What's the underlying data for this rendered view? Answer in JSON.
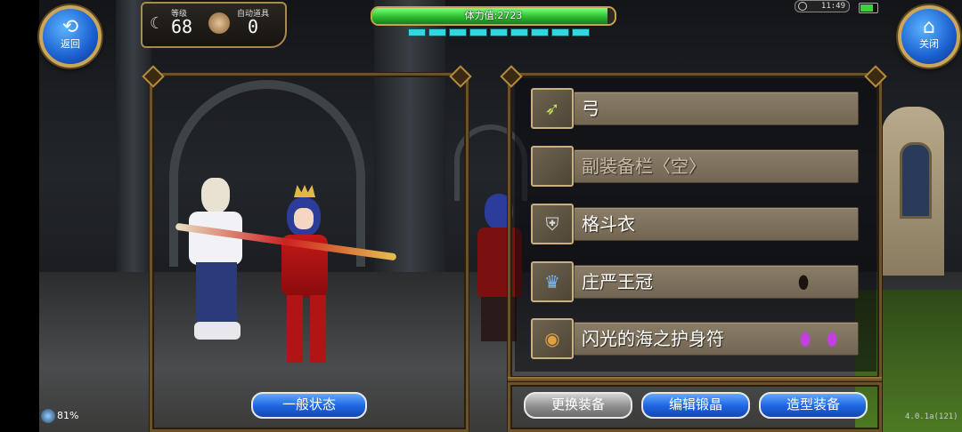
{
  "top_left": {
    "back_label": "返回",
    "back_glyph": "⟲",
    "level_label": "等级",
    "level_value": "68",
    "auto_item_label": "自动道具",
    "auto_item_value": "0"
  },
  "top_right": {
    "close_label": "关闭",
    "close_glyph": "⌂",
    "clock": "11:49"
  },
  "stamina": {
    "text": "体力值:2723",
    "fill_fraction": 0.97,
    "segments": 9
  },
  "equipment": [
    {
      "label": "弓",
      "icon": "bow-icon",
      "empty": false,
      "gems": 0
    },
    {
      "label": "副装备栏〈空〉",
      "icon": "empty-slot",
      "empty": true,
      "gems": 0
    },
    {
      "label": "格斗衣",
      "icon": "armor-icon",
      "empty": false,
      "gems": 0
    },
    {
      "label": "庄严王冠",
      "icon": "crown-icon",
      "empty": false,
      "gems": 1
    },
    {
      "label": "闪光的海之护身符",
      "icon": "amulet-icon",
      "empty": false,
      "gems": 2
    }
  ],
  "buttons": {
    "state": "一般状态",
    "change_equip": "更换装备",
    "edit_crystal": "编辑锻晶",
    "appearance_equip": "造型装备"
  },
  "status": {
    "network": "81%",
    "version": "4.0.1a(121)"
  },
  "colors": {
    "accent_blue": "#1d63e0",
    "gold_frame": "#b48a3c",
    "stamina_green": "#28b82a"
  }
}
